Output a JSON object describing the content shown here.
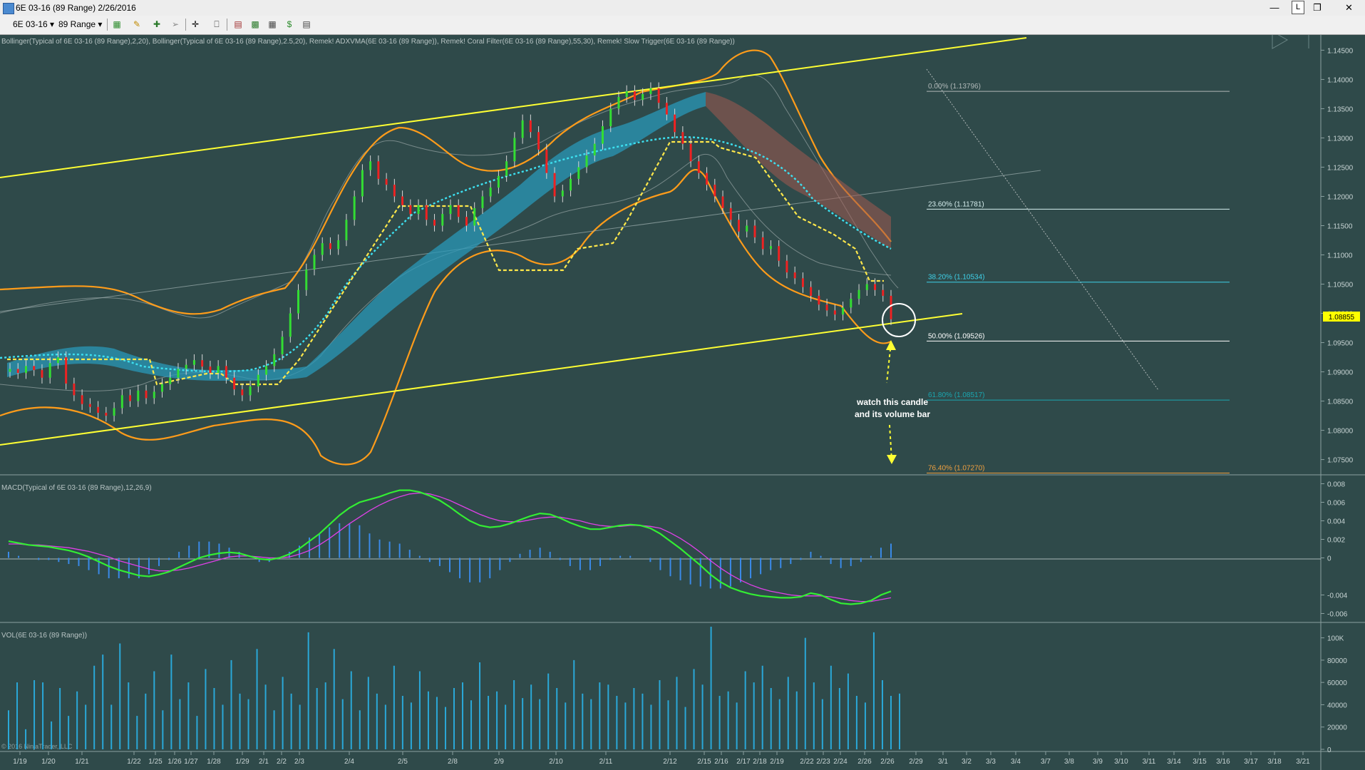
{
  "window": {
    "title": "6E 03-16 (89 Range)  2/26/2016",
    "lock_label": "L"
  },
  "toolbar": {
    "instrument": "6E 03-16",
    "interval": "89 Range"
  },
  "price_panel": {
    "indicators_text": "Bollinger(Typical of 6E 03-16 (89 Range),2,20), Bollinger(Typical of 6E 03-16 (89 Range),2.5,20), Remek! ADXVMA(6E 03-16 (89 Range)), Remek! Coral Filter(6E 03-16 (89 Range),55,30), Remek! Slow Trigger(6E 03-16 (89 Range))",
    "y_ticks": [
      "1.14500",
      "1.14000",
      "1.13500",
      "1.13000",
      "1.12500",
      "1.12000",
      "1.11500",
      "1.11000",
      "1.10500",
      "1.10000",
      "1.09500",
      "1.09000",
      "1.08500",
      "1.08000",
      "1.07500"
    ],
    "last_price": "1.08855",
    "fib_levels": [
      {
        "label": "0.00% (1.13796)",
        "price": 1.13796,
        "color": "#b0b8b8"
      },
      {
        "label": "23.60% (1.11781)",
        "price": 1.11781,
        "color": "#d8f0f0"
      },
      {
        "label": "38.20% (1.10534)",
        "price": 1.10534,
        "color": "#3fd0e8"
      },
      {
        "label": "50.00% (1.09526)",
        "price": 1.09526,
        "color": "#ffffff"
      },
      {
        "label": "61.80% (1.08517)",
        "price": 1.08517,
        "color": "#1aa6b0"
      },
      {
        "label": "76.40% (1.07270)",
        "price": 1.0727,
        "color": "#f0a040"
      }
    ],
    "annotation_line1": "watch this candle",
    "annotation_line2": "and its volume bar"
  },
  "macd_panel": {
    "label": "MACD(Typical of 6E 03-16 (89 Range),12,26,9)",
    "y_ticks": [
      "0.008",
      "0.006",
      "0.004",
      "0.002",
      "0",
      "-0.004",
      "-0.006"
    ]
  },
  "volume_panel": {
    "label": "VOL(6E 03-16 (89 Range))",
    "y_ticks": [
      "100K",
      "80000",
      "60000",
      "40000",
      "20000",
      "0"
    ],
    "copyright": "© 2016 NinjaTrader, LLC"
  },
  "x_axis": {
    "labels": [
      "1/19",
      "1/20",
      "1/21",
      "1/22",
      "1/25",
      "1/26",
      "1/27",
      "1/28",
      "1/29",
      "2/1",
      "2/2",
      "2/3",
      "2/4",
      "2/5",
      "2/8",
      "2/9",
      "2/10",
      "2/11",
      "2/12",
      "2/15",
      "2/16",
      "2/17",
      "2/18",
      "2/19",
      "2/22",
      "2/23",
      "2/24",
      "2/26",
      "2/26",
      "2/29",
      "3/1",
      "3/2",
      "3/3",
      "3/4",
      "3/7",
      "3/8",
      "3/9",
      "3/10",
      "3/11",
      "3/14",
      "3/15",
      "3/16",
      "3/17",
      "3/18",
      "3/21"
    ]
  },
  "chart_data": {
    "type": "candlestick",
    "y_axis_range": [
      1.073,
      1.147
    ],
    "macd_range": [
      -0.0065,
      0.0085
    ],
    "volume_range": [
      0,
      110000
    ],
    "close": [
      1.0905,
      1.0898,
      1.091,
      1.0903,
      1.089,
      1.0915,
      1.0925,
      1.088,
      1.086,
      1.0845,
      1.084,
      1.083,
      1.0825,
      1.0838,
      1.086,
      1.085,
      1.0868,
      1.0855,
      1.0866,
      1.0879,
      1.089,
      1.0905,
      1.0912,
      1.092,
      1.0909,
      1.0898,
      1.091,
      1.089,
      1.087,
      1.086,
      1.0875,
      1.0895,
      1.091,
      1.093,
      1.096,
      1.1,
      1.104,
      1.1075,
      1.11,
      1.112,
      1.111,
      1.1125,
      1.116,
      1.12,
      1.1245,
      1.126,
      1.123,
      1.122,
      1.12,
      1.1185,
      1.117,
      1.1185,
      1.116,
      1.115,
      1.117,
      1.1185,
      1.1165,
      1.115,
      1.118,
      1.12,
      1.1215,
      1.1235,
      1.126,
      1.13,
      1.133,
      1.131,
      1.128,
      1.124,
      1.12,
      1.121,
      1.123,
      1.125,
      1.127,
      1.129,
      1.132,
      1.135,
      1.137,
      1.138,
      1.1365,
      1.1375,
      1.1385,
      1.136,
      1.134,
      1.131,
      1.129,
      1.126,
      1.124,
      1.122,
      1.12,
      1.118,
      1.116,
      1.114,
      1.115,
      1.113,
      1.111,
      1.1115,
      1.109,
      1.107,
      1.106,
      1.1045,
      1.103,
      1.1015,
      1.1005,
      1.0998,
      1.101,
      1.1025,
      1.104,
      1.105,
      1.104,
      1.103,
      1.099
    ],
    "macd": [
      0.0018,
      0.0016,
      0.0014,
      0.0013,
      0.0012,
      0.001,
      0.0008,
      0.0005,
      0.0001,
      -0.0004,
      -0.0009,
      -0.0013,
      -0.0016,
      -0.0019,
      -0.002,
      -0.0018,
      -0.0015,
      -0.001,
      -0.0005,
      0.0,
      0.0003,
      0.0005,
      0.0006,
      0.0005,
      0.0002,
      -0.0001,
      -0.0002,
      0.0,
      0.0004,
      0.001,
      0.0018,
      0.0026,
      0.0036,
      0.0046,
      0.0054,
      0.006,
      0.0063,
      0.0066,
      0.007,
      0.0073,
      0.0073,
      0.0071,
      0.0067,
      0.0062,
      0.0055,
      0.0047,
      0.004,
      0.0035,
      0.0033,
      0.0034,
      0.0037,
      0.0041,
      0.0045,
      0.0048,
      0.0047,
      0.0043,
      0.0038,
      0.0034,
      0.0031,
      0.0031,
      0.0033,
      0.0035,
      0.0036,
      0.0035,
      0.0032,
      0.0026,
      0.0018,
      0.001,
      0.0001,
      -0.0008,
      -0.0018,
      -0.0026,
      -0.0032,
      -0.0036,
      -0.0039,
      -0.0041,
      -0.0042,
      -0.0043,
      -0.0043,
      -0.0042,
      -0.0038,
      -0.004,
      -0.0045,
      -0.0049,
      -0.005,
      -0.0049,
      -0.0046,
      -0.004,
      -0.0036
    ],
    "signal": [
      0.0015,
      0.0015,
      0.0014,
      0.0014,
      0.0013,
      0.0012,
      0.0011,
      0.0009,
      0.0007,
      0.0004,
      0.0001,
      -0.0003,
      -0.0006,
      -0.0009,
      -0.0012,
      -0.0014,
      -0.0014,
      -0.0013,
      -0.0011,
      -0.0008,
      -0.0005,
      -0.0002,
      0.0001,
      0.0002,
      0.0002,
      0.0001,
      0.0,
      0.0,
      0.0001,
      0.0004,
      0.0008,
      0.0014,
      0.0021,
      0.0029,
      0.0037,
      0.0044,
      0.0051,
      0.0057,
      0.0062,
      0.0066,
      0.0069,
      0.007,
      0.0069,
      0.0066,
      0.0062,
      0.0057,
      0.0052,
      0.0047,
      0.0043,
      0.004,
      0.0039,
      0.0039,
      0.0041,
      0.0043,
      0.0044,
      0.0044,
      0.0042,
      0.004,
      0.0037,
      0.0035,
      0.0034,
      0.0034,
      0.0035,
      0.0035,
      0.0034,
      0.0032,
      0.0027,
      0.0021,
      0.0014,
      0.0006,
      -0.0003,
      -0.0011,
      -0.0018,
      -0.0024,
      -0.0029,
      -0.0033,
      -0.0036,
      -0.0038,
      -0.004,
      -0.0041,
      -0.0041,
      -0.0041,
      -0.0042,
      -0.0044,
      -0.0046,
      -0.0047,
      -0.0047,
      -0.0045,
      -0.0043
    ],
    "volume": [
      35000,
      60000,
      18000,
      62000,
      60000,
      25000,
      55000,
      30000,
      52000,
      40000,
      75000,
      85000,
      40000,
      95000,
      60000,
      30000,
      50000,
      70000,
      35000,
      85000,
      45000,
      60000,
      30000,
      72000,
      55000,
      40000,
      80000,
      50000,
      45000,
      90000,
      58000,
      35000,
      65000,
      50000,
      40000,
      105000,
      55000,
      60000,
      90000,
      45000,
      70000,
      35000,
      65000,
      50000,
      40000,
      75000,
      48000,
      42000,
      70000,
      52000,
      47000,
      38000,
      55000,
      60000,
      44000,
      78000,
      48000,
      52000,
      40000,
      62000,
      46000,
      58000,
      45000,
      68000,
      55000,
      42000,
      80000,
      50000,
      45000,
      60000,
      58000,
      48000,
      42000,
      55000,
      50000,
      40000,
      62000,
      44000,
      65000,
      38000,
      72000,
      58000,
      110000,
      48000,
      52000,
      42000,
      70000,
      60000,
      75000,
      55000,
      45000,
      65000,
      52000,
      100000,
      60000,
      45000,
      75000,
      55000,
      68000,
      48000,
      42000,
      105000,
      62000,
      48000,
      50000
    ]
  }
}
